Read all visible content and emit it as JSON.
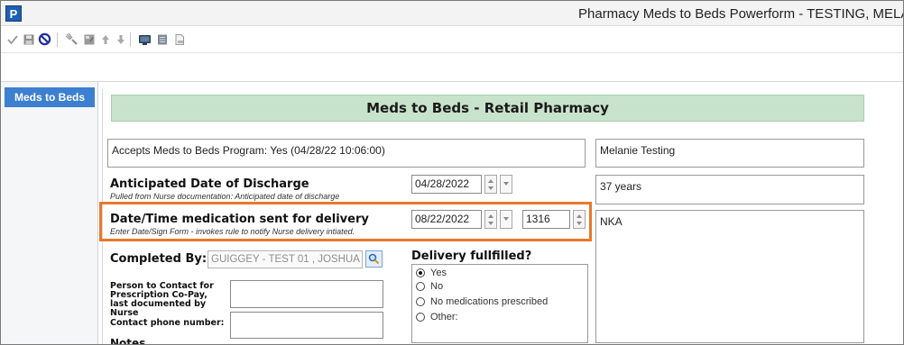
{
  "window": {
    "app_icon_letter": "P",
    "title": "Pharmacy Meds to Beds Powerform - TESTING, MELANIE"
  },
  "toolbar": {
    "buttons": [
      "checkmark-icon",
      "save-icon",
      "cancel-icon",
      "tools-icon",
      "form-icon",
      "arrow-up-icon",
      "arrow-down-icon",
      "monitor-icon",
      "document-icon",
      "print-icon"
    ]
  },
  "nav": {
    "items": [
      {
        "label": "Meds to Beds"
      }
    ]
  },
  "form": {
    "banner": "Meds to Beds - Retail Pharmacy",
    "accepts_program": "Accepts Meds to Beds Program: Yes (04/28/22 10:06:00)",
    "patient_name": "Melanie Testing",
    "age": "37 years",
    "allergies": "NKA",
    "discharge": {
      "label": "Anticipated Date of Discharge",
      "sublabel": "Pulled from Nurse documentation: Anticipated date of discharge",
      "date": "04/28/2022"
    },
    "delivery_time": {
      "label": "Date/Time medication sent for delivery",
      "sublabel": "Enter Date/Sign Form - invokes rule to notify Nurse delivery intiated.",
      "date": "08/22/2022",
      "time": "1316"
    },
    "completed_by": {
      "label": "Completed By:",
      "value": "GUIGGEY - TEST 01 , JOSHUA"
    },
    "contact_person_label": "Person to Contact for Prescription Co-Pay, last documented by Nurse",
    "contact_phone_label": "Contact phone number:",
    "notes_label": "Notes",
    "delivery_fulfilled": {
      "label": "Delivery fullfilled?",
      "options": [
        {
          "label": "Yes",
          "selected": true
        },
        {
          "label": "No",
          "selected": false
        },
        {
          "label": "No medications prescribed",
          "selected": false
        },
        {
          "label": "Other:",
          "selected": false
        }
      ]
    }
  },
  "colors": {
    "banner_bg": "#c7e3cb",
    "nav_selected": "#3d7fd0",
    "highlight": "#e8782a"
  }
}
